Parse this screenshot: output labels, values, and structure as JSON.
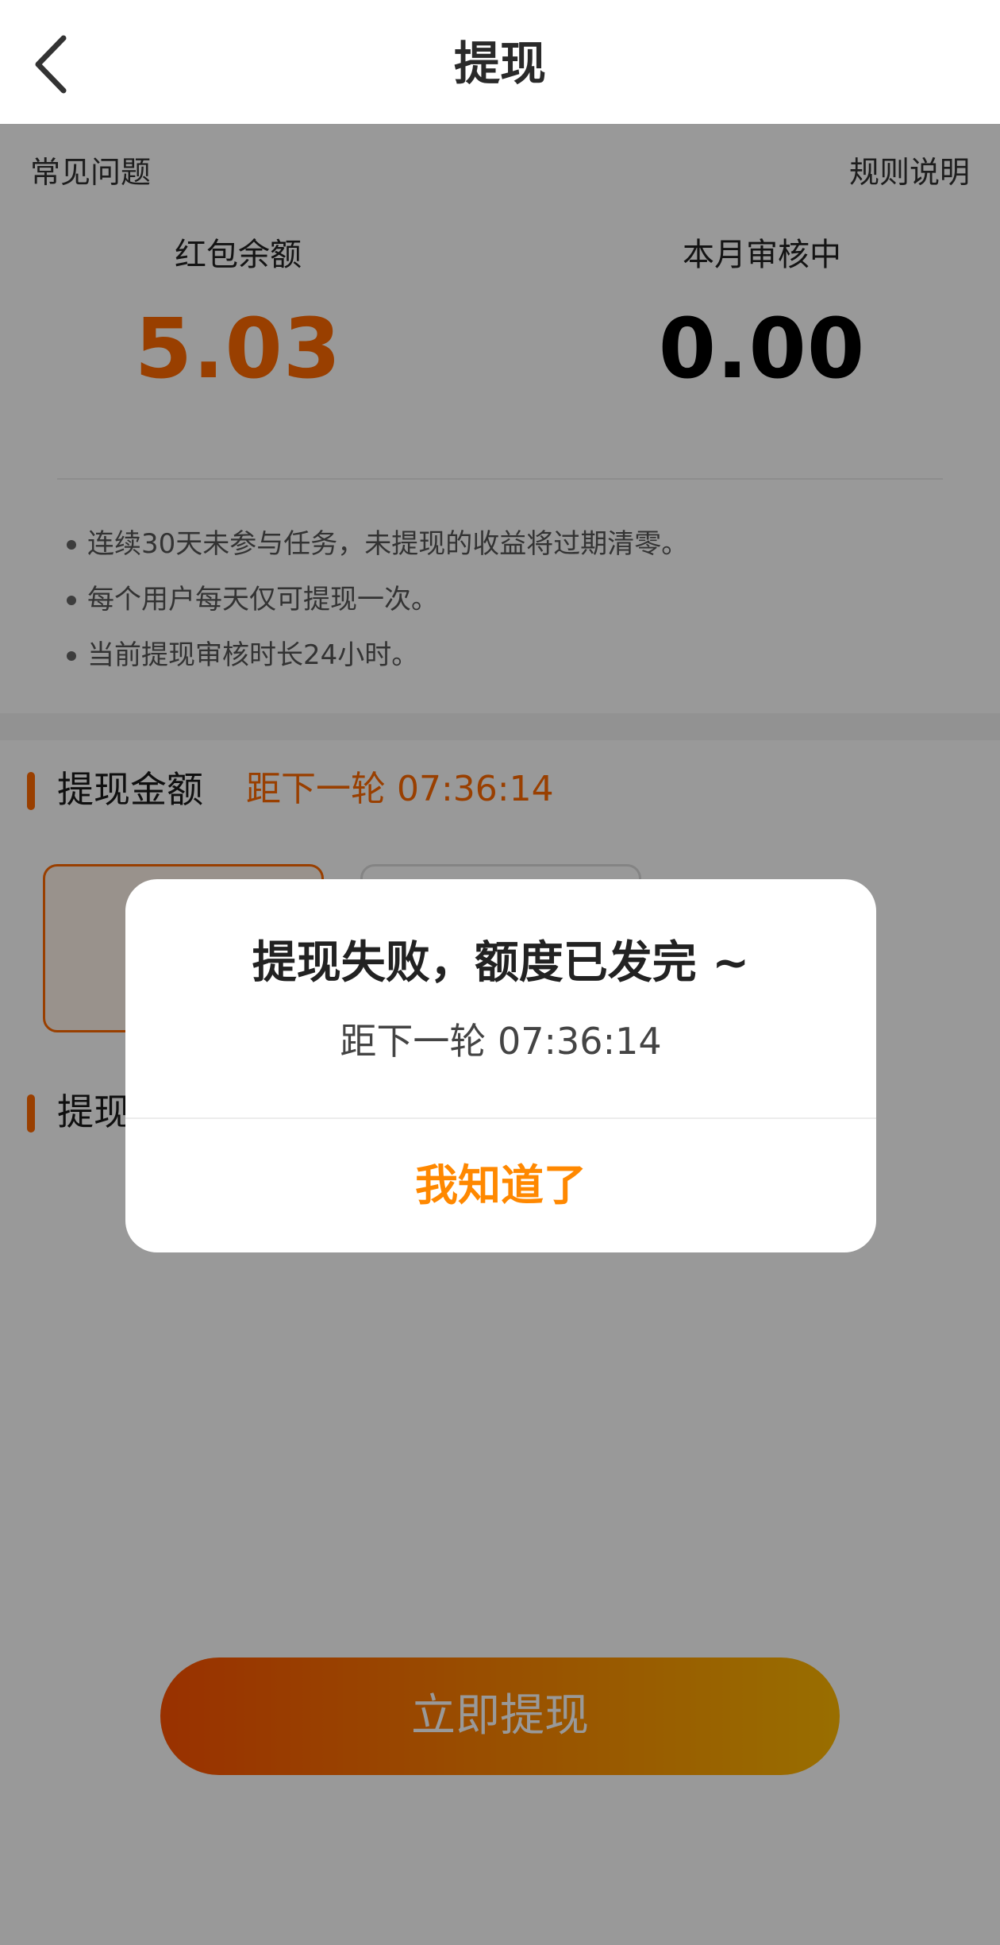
{
  "header": {
    "title": "提现"
  },
  "top_links": {
    "faq": "常见问题",
    "rules": "规则说明"
  },
  "stats": {
    "balance_label": "红包余额",
    "balance_value": "5.03",
    "pending_label": "本月审核中",
    "pending_value": "0.00"
  },
  "rules": [
    "连续30天未参与任务，未提现的收益将过期清零。",
    "每个用户每天仅可提现一次。",
    "当前提现审核时长24小时。"
  ],
  "amount_section": {
    "title": "提现金额",
    "countdown": "距下一轮 07:36:14"
  },
  "method_section": {
    "title": "提现"
  },
  "submit": {
    "label": "立即提现"
  },
  "dialog": {
    "title": "提现失败，额度已发完 ~",
    "subtitle": "距下一轮 07:36:14",
    "confirm": "我知道了"
  },
  "colors": {
    "accent": "#ff6a00",
    "dialog_button": "#ff8800",
    "overlay": "rgba(0,0,0,0.4)"
  }
}
